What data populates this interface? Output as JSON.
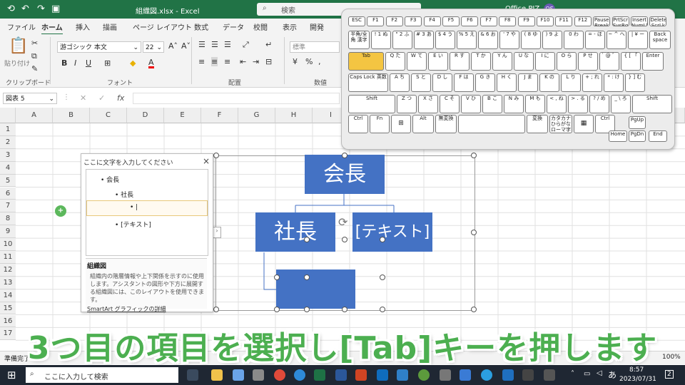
{
  "titlebar": {
    "filename": "組織図.xlsx",
    "sep": "-",
    "app": "Excel",
    "search_placeholder": "検索",
    "account": "Office PIZ",
    "avatar": "OS"
  },
  "ribbon": {
    "tabs": [
      "ファイル",
      "ホーム",
      "挿入",
      "描画",
      "ページ レイアウト",
      "数式",
      "データ",
      "校閲",
      "表示",
      "開発"
    ],
    "active_tab": "ホーム",
    "paste_label": "貼り付け",
    "clipboard_label": "クリップボード",
    "font_name": "游ゴシック 本文",
    "font_size": "22",
    "font_label": "フォント",
    "align_label": "配置",
    "number_format": "標準",
    "number_label": "数値",
    "bold": "B",
    "italic": "I",
    "underline": "U",
    "font_color": "A"
  },
  "formula_bar": {
    "namebox": "図表 5",
    "fx": "fx"
  },
  "columns": [
    "A",
    "B",
    "C",
    "D",
    "E",
    "F",
    "G",
    "H",
    "I"
  ],
  "rows": [
    "1",
    "2",
    "3",
    "4",
    "5",
    "6",
    "7",
    "8",
    "9",
    "10",
    "11",
    "12",
    "13",
    "14",
    "15",
    "16",
    "17"
  ],
  "text_pane": {
    "title": "ここに文字を入力してください",
    "close": "×",
    "items": [
      {
        "label": "会長"
      },
      {
        "label": "社長"
      },
      {
        "label": "|"
      },
      {
        "label": "[テキスト]"
      }
    ],
    "desc_title": "組織図",
    "desc_body": "組織内の階層情報や上下関係を示すのに使用します。アシスタントの図形や下方に展開する組織図には、このレイアウトを使用できます。",
    "link": "SmartArt グラフィックの詳細"
  },
  "smartart": {
    "top": "会長",
    "left": "社長",
    "right": "[テキスト]",
    "bottom": ""
  },
  "keyboard": {
    "row1": [
      "ESC",
      "F1",
      "F2",
      "F3",
      "F4",
      "F5",
      "F6",
      "F7",
      "F8",
      "F9",
      "F10",
      "F11",
      "F12",
      "Pause Break",
      "PrtScr SysRq",
      "Insert NumLk",
      "Delete ScrLk"
    ],
    "row2": [
      "半角/全角 漢字",
      "! 1 ぬ",
      "\" 2 ふ",
      "# 3 あ",
      "$ 4 う",
      "% 5 え",
      "& 6 お",
      "' 7 や",
      "( 8 ゆ",
      ") 9 よ",
      "0 わ",
      "= - ほ",
      "~ ^ へ",
      "| ¥ ー",
      "Back space"
    ],
    "row3": [
      "Tab",
      "Q た",
      "W て",
      "E い",
      "R す",
      "T か",
      "Y ん",
      "U な",
      "I に",
      "O ら",
      "P せ",
      "` @ ゛",
      "{ [ 「",
      "Enter"
    ],
    "row4": [
      "Caps Lock 英数",
      "A ち",
      "S と",
      "D し",
      "F は",
      "G き",
      "H く",
      "J ま",
      "K の",
      "L り",
      "+ ; れ",
      "* : け",
      "} ] む"
    ],
    "row5": [
      "Shift",
      "Z つ",
      "X さ",
      "C そ",
      "V ひ",
      "B こ",
      "N み",
      "M も",
      "< , ね",
      "> . る",
      "? / め",
      "_ \\ ろ",
      "Shift"
    ],
    "row6": [
      "Ctrl",
      "Fn",
      "win-icon",
      "Alt",
      "無変換",
      "",
      "変換",
      "カタカナ ひらがな ローマ字",
      "app-icon",
      "Ctrl"
    ],
    "nav": [
      "PgUp",
      "Home",
      "PgDn",
      "End"
    ],
    "highlight": "Tab",
    "highlight_color": "#f4c542"
  },
  "caption": "3つ目の項目を選択し[Tab]キーを押します",
  "status": {
    "left": "準備完了",
    "zoom": "100%"
  },
  "taskbar": {
    "search_placeholder": "ここに入力して検索",
    "time": "8:57",
    "date": "2023/07/31",
    "ime": "あ",
    "notify": "2"
  }
}
